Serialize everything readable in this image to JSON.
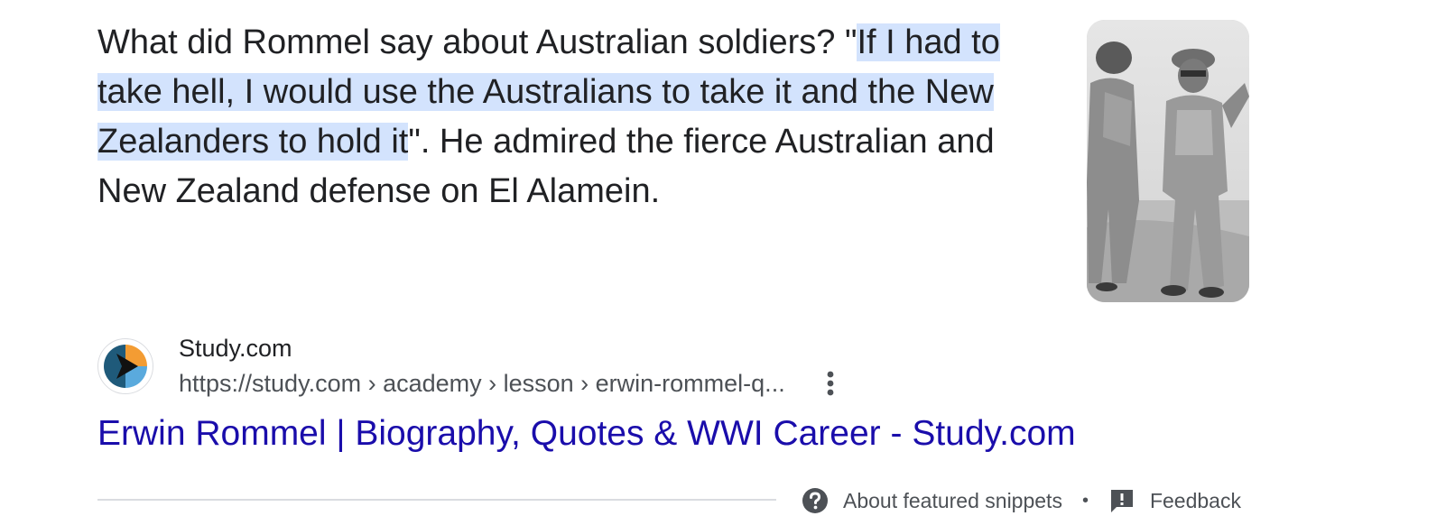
{
  "snippet": {
    "before": "What did Rommel say about Australian soldiers? \"",
    "highlight": "If I had to take hell, I would use the Australians to take it and the New Zealanders to hold it",
    "after": "\". He admired the fierce Australian and New Zealand defense on El Alamein."
  },
  "thumbnail": {
    "icon": "photo-two-soldiers-desert"
  },
  "source": {
    "site_name": "Study.com",
    "url": "https://study.com › academy › lesson › erwin-rommel-q...",
    "favicon": "study-com-logo"
  },
  "result": {
    "title": "Erwin Rommel | Biography, Quotes & WWI Career - Study.com"
  },
  "footer": {
    "about_label": "About featured snippets",
    "separator": "•",
    "feedback_label": "Feedback"
  },
  "colors": {
    "highlight": "#d3e3fd",
    "link": "#1a0dab",
    "text": "#202124",
    "muted": "#4d5156"
  }
}
